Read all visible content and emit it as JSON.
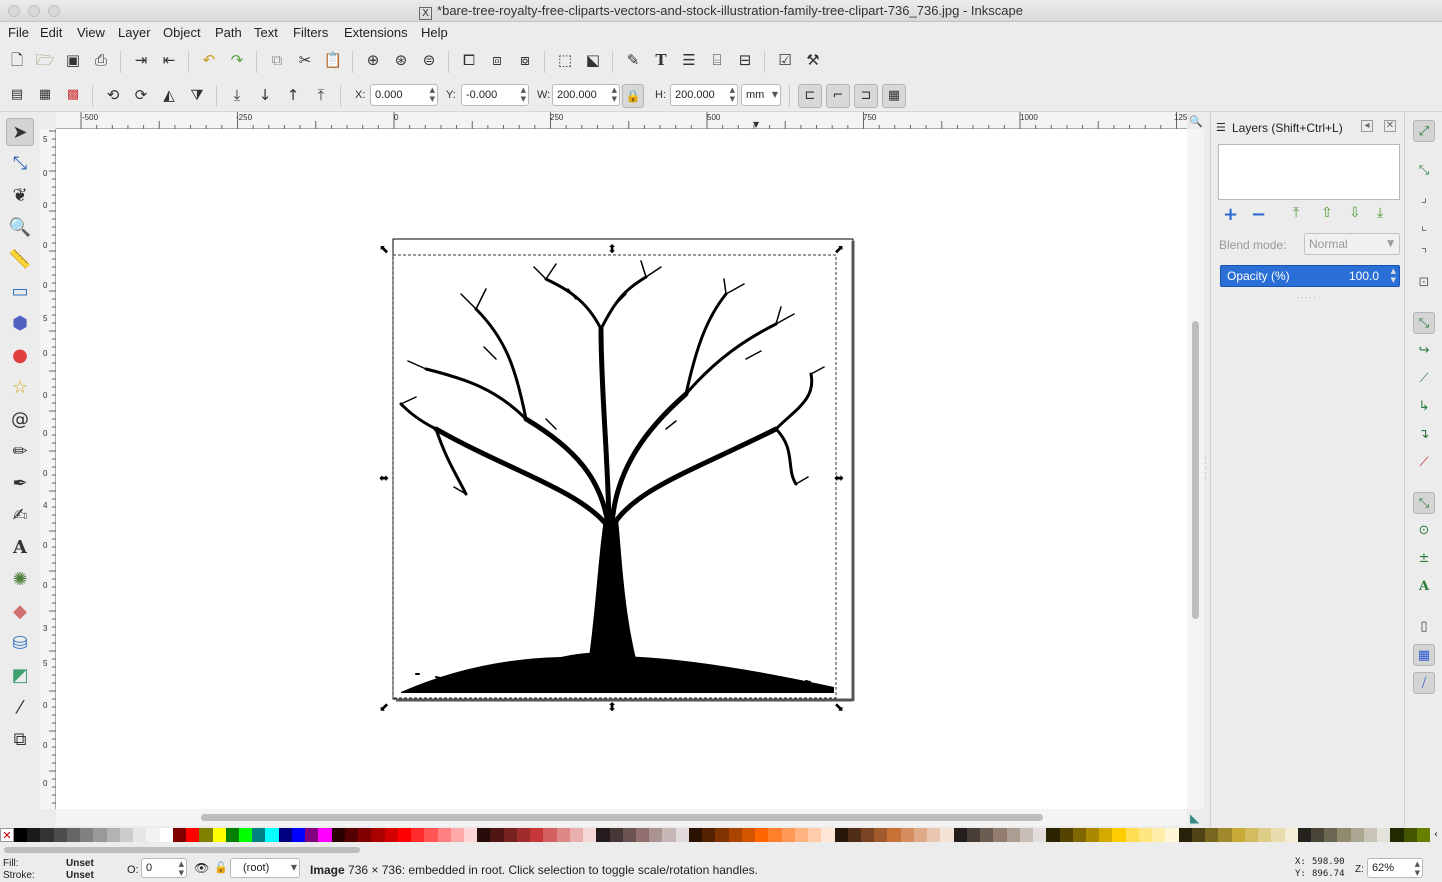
{
  "window": {
    "title": "*bare-tree-royalty-free-cliparts-vectors-and-stock-illustration-family-tree-clipart-736_736.jpg - Inkscape",
    "x_glyph": "X"
  },
  "menu": [
    "File",
    "Edit",
    "View",
    "Layer",
    "Object",
    "Path",
    "Text",
    "Filters",
    "Extensions",
    "Help"
  ],
  "toolbar": {
    "x_label": "X:",
    "x_value": "0.000",
    "y_label": "Y:",
    "y_value": "-0.000",
    "w_label": "W:",
    "w_value": "200.000",
    "h_label": "H:",
    "h_value": "200.000",
    "unit": "mm"
  },
  "ruler": {
    "h_ticks": [
      "-500",
      "-250",
      "0",
      "250",
      "500",
      "750",
      "1000",
      "125"
    ],
    "v_ticks": [
      "5",
      "0",
      "0",
      "0",
      "0",
      "5",
      "0",
      "0",
      "0",
      "0",
      "4",
      "0",
      "0",
      "3",
      "5",
      "0",
      "0",
      "0"
    ]
  },
  "layers_panel": {
    "title": "Layers (Shift+Ctrl+L)",
    "blend_label": "Blend mode:",
    "blend_value": "Normal",
    "opacity_label": "Opacity (%)",
    "opacity_value": "100.0"
  },
  "palette": [
    "#000000",
    "#1a1a1a",
    "#333333",
    "#4d4d4d",
    "#666666",
    "#808080",
    "#999999",
    "#b3b3b3",
    "#cccccc",
    "#e6e6e6",
    "#f2f2f2",
    "#ffffff",
    "#800000",
    "#ff0000",
    "#808000",
    "#ffff00",
    "#008000",
    "#00ff00",
    "#008080",
    "#00ffff",
    "#000080",
    "#0000ff",
    "#800080",
    "#ff00ff",
    "#2b0000",
    "#550000",
    "#800000",
    "#aa0000",
    "#d40000",
    "#ff0000",
    "#ff2a2a",
    "#ff5555",
    "#ff8080",
    "#ffaaaa",
    "#ffd5d5",
    "#280b0b",
    "#501616",
    "#782121",
    "#a02c2c",
    "#c83737",
    "#d35f5f",
    "#de8787",
    "#e9afaf",
    "#f4d7d7",
    "#241c1c",
    "#483737",
    "#6c5353",
    "#916f6f",
    "#ac9393",
    "#c8b7b7",
    "#e3dbdb",
    "#2b1100",
    "#552200",
    "#803300",
    "#aa4400",
    "#d45500",
    "#ff6600",
    "#ff7f2a",
    "#ff9955",
    "#ffb380",
    "#ffccaa",
    "#ffe6d5",
    "#28170b",
    "#502d16",
    "#784421",
    "#a05a2c",
    "#c87137",
    "#d38d5f",
    "#deaa87",
    "#e9c6af",
    "#f4e3d7",
    "#241f1c",
    "#483e37",
    "#6c5d53",
    "#917c6f",
    "#ac9d93",
    "#c8beb7",
    "#e3dedb",
    "#2b2200",
    "#554400",
    "#806600",
    "#aa8800",
    "#d4aa00",
    "#ffcc00",
    "#ffdd55",
    "#ffe680",
    "#ffeeaa",
    "#fff6d5",
    "#28220b",
    "#504416",
    "#786721",
    "#a0892c",
    "#c8ab37",
    "#d3bc5f",
    "#decd87",
    "#e9ddaf",
    "#f4eed7",
    "#24221c",
    "#484537",
    "#6c6753",
    "#918a6f",
    "#aca793",
    "#c8c4b7",
    "#e3e2db",
    "#222b00",
    "#445500",
    "#668000"
  ],
  "status": {
    "fill_label": "Fill:",
    "fill_value": "Unset",
    "stroke_label": "Stroke:",
    "stroke_value": "Unset",
    "o_label": "O:",
    "o_value": "0",
    "layer": "(root)",
    "message_bold": "Image",
    "message": " 736 × 736: embedded in root. Click selection to toggle scale/rotation handles.",
    "x_label": "X:",
    "x_coord": "598.90",
    "y_label": "Y:",
    "y_coord": "896.74",
    "z_label": "Z:",
    "zoom": "62%"
  }
}
